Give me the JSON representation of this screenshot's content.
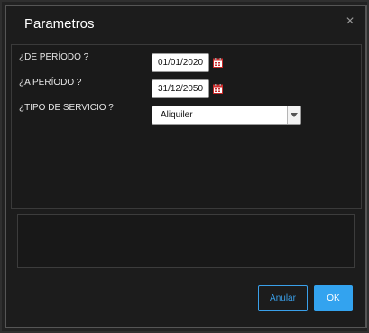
{
  "dialog": {
    "title": "Parametros",
    "close_label": "×"
  },
  "params": {
    "from_label": "¿DE PERÍODO ?",
    "from_value": "01/01/2020",
    "to_label": "¿A PERÍODO ?",
    "to_value": "31/12/2050",
    "service_label": "¿TIPO DE SERVICIO ?",
    "service_value": "Aliquiler"
  },
  "buttons": {
    "cancel_label": "Anular",
    "ok_label": "OK"
  },
  "icons": {
    "calendar": "calendar-icon",
    "dropdown": "chevron-down-icon",
    "close": "close-icon"
  },
  "colors": {
    "accent": "#33a3ef",
    "background": "#1c1c1c",
    "calendar_red": "#d32f2f"
  }
}
